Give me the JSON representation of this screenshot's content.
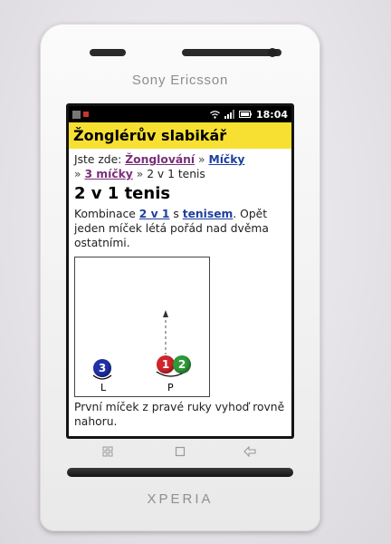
{
  "device": {
    "brand": "Sony Ericsson",
    "model_logo": "XPERIA"
  },
  "statusbar": {
    "time": "18:04"
  },
  "app": {
    "title": "Žonglérův slabikář"
  },
  "breadcrumb": {
    "prefix": "Jste zde:",
    "items": [
      "Žonglování",
      "Míčky",
      "3 míčky"
    ],
    "sep": "»",
    "current": "2 v 1 tenis"
  },
  "page": {
    "heading": "2 v 1 tenis",
    "intro_parts": [
      "Kombinace ",
      "2 v 1",
      " s ",
      "tenisem",
      ". Opět jeden míček létá pořád nad dvěma ostatními."
    ],
    "caption": "První míček z pravé ruky vyhoď rovně nahoru."
  },
  "animation": {
    "balls": [
      "3",
      "1",
      "2"
    ],
    "hands": [
      "L",
      "P"
    ],
    "colors": {
      "ball_1": "#d3242c",
      "ball_2": "#2f9a3a",
      "ball_3": "#2132a8"
    }
  },
  "softkeys": {
    "menu_icon": "grid-icon",
    "home_icon": "square-icon",
    "back_icon": "back-arrow-icon"
  },
  "colors": {
    "titlebar_bg": "#f7e032",
    "visited_link": "#7a2e7a",
    "link": "#1d3f9e"
  }
}
